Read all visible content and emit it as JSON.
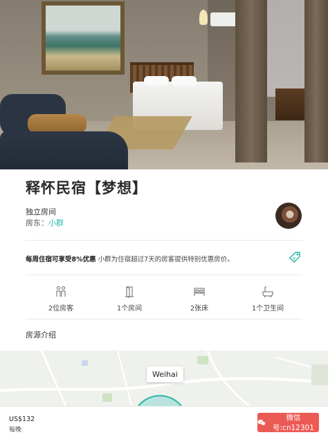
{
  "listing": {
    "title": "释怀民宿【梦想】",
    "room_type": "独立房间",
    "host_label": "房东：",
    "host_name": "小群"
  },
  "discount": {
    "headline": "每周住宿可享受8%优惠",
    "detail": "小群为住宿超过7天的房客提供特别优惠房价。"
  },
  "amenities": [
    {
      "icon": "guests-icon",
      "label": "2位房客"
    },
    {
      "icon": "door-icon",
      "label": "1个房间"
    },
    {
      "icon": "bed-icon",
      "label": "2张床"
    },
    {
      "icon": "bathtub-icon",
      "label": "1个卫生间"
    }
  ],
  "section": {
    "description_title": "房源介绍"
  },
  "map": {
    "city_label": "Weihai"
  },
  "booking": {
    "price": "US$132",
    "per": "每晚",
    "button_text": "微信号:cn12301"
  },
  "colors": {
    "accent_teal": "#2ab7a9",
    "button_red": "#ec5a56"
  }
}
